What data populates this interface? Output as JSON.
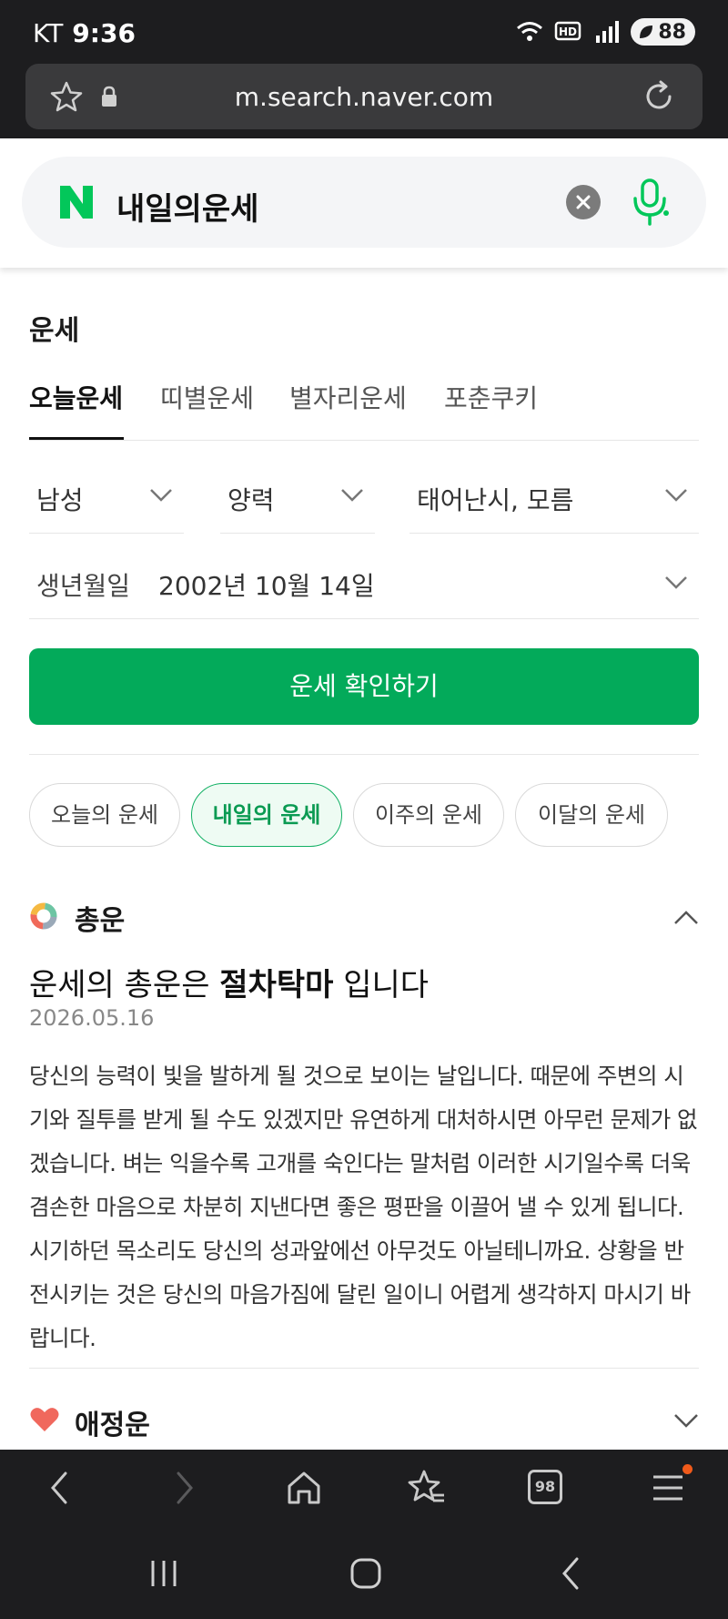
{
  "status_bar": {
    "carrier": "KT",
    "time": "9:36",
    "battery": "88"
  },
  "url_bar": {
    "url": "m.search.naver.com"
  },
  "search": {
    "query": "내일의운세"
  },
  "fortune": {
    "section_title": "운세",
    "tabs": [
      {
        "label": "오늘운세",
        "active": true
      },
      {
        "label": "띠별운세",
        "active": false
      },
      {
        "label": "별자리운세",
        "active": false
      },
      {
        "label": "포춘쿠키",
        "active": false
      }
    ],
    "gender": "남성",
    "calendar": "양력",
    "birth_time": "태어난시, 모름",
    "birth_label": "생년월일",
    "birth_value": "2002년 10월 14일",
    "check_button": "운세 확인하기",
    "periods": [
      {
        "label": "오늘의 운세",
        "active": false
      },
      {
        "label": "내일의 운세",
        "active": true
      },
      {
        "label": "이주의 운세",
        "active": false
      },
      {
        "label": "이달의 운세",
        "active": false
      }
    ],
    "overall": {
      "title": "총운",
      "headline_prefix": "운세의 총운은 ",
      "headline_strong": "절차탁마",
      "headline_suffix": " 입니다",
      "date": "2026.05.16",
      "text": "당신의 능력이 빛을 발하게 될 것으로 보이는 날입니다. 때문에 주변의 시기와 질투를 받게 될 수도 있겠지만 유연하게 대처하시면 아무런 문제가 없겠습니다. 벼는 익을수록 고개를 숙인다는 말처럼 이러한 시기일수록 더욱 겸손한 마음으로 차분히 지낸다면 좋은 평판을 이끌어 낼 수 있게 됩니다. 시기하던 목소리도 당신의 성과앞에선 아무것도 아닐테니까요. 상황을 반전시키는 것은 당신의 마음가짐에 달린 일이니 어렵게 생각하지 마시기 바랍니다."
    },
    "love": {
      "title": "애정운"
    }
  },
  "browser_toolbar": {
    "tab_count": "98"
  },
  "colors": {
    "naver_green": "#03c75a",
    "button_green": "#03aa5a",
    "dark_chrome": "#1d1d1f"
  }
}
